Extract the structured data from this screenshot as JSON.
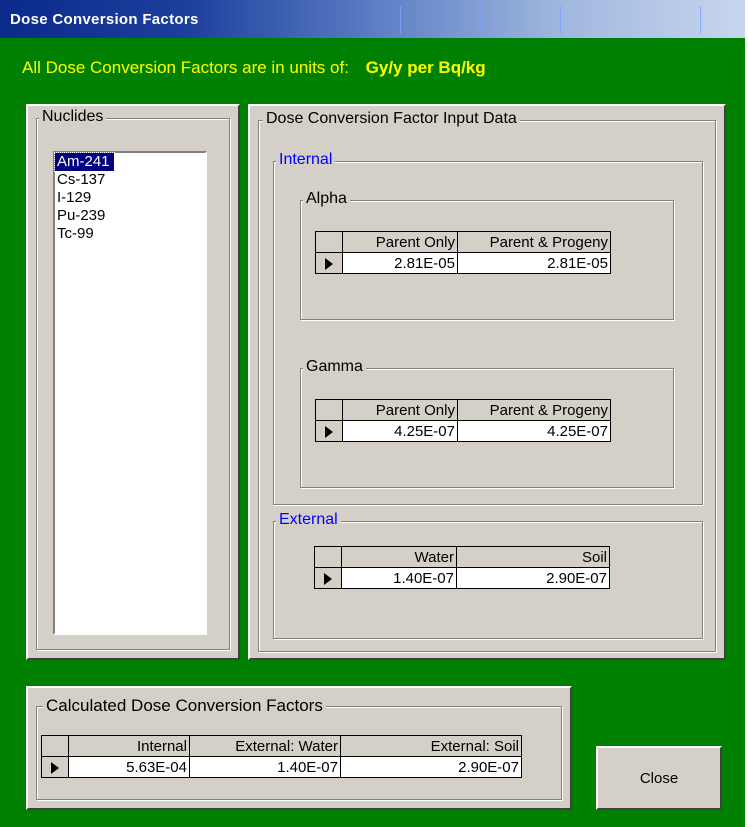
{
  "window": {
    "title": "Dose Conversion Factors"
  },
  "units": {
    "label": "All Dose Conversion Factors are in units of:",
    "value": "Gy/y per Bq/kg"
  },
  "nuclides": {
    "legend": "Nuclides",
    "items": [
      "Am-241",
      "Cs-137",
      "I-129",
      "Pu-239",
      "Tc-99"
    ],
    "selected_index": 0
  },
  "input_data": {
    "legend": "Dose Conversion Factor Input Data",
    "internal": {
      "legend": "Internal",
      "alpha": {
        "legend": "Alpha",
        "headers": [
          "Parent Only",
          "Parent & Progeny"
        ],
        "values": [
          "2.81E-05",
          "2.81E-05"
        ]
      },
      "gamma": {
        "legend": "Gamma",
        "headers": [
          "Parent Only",
          "Parent & Progeny"
        ],
        "values": [
          "4.25E-07",
          "4.25E-07"
        ]
      }
    },
    "external": {
      "legend": "External",
      "headers": [
        "Water",
        "Soil"
      ],
      "values": [
        "1.40E-07",
        "2.90E-07"
      ]
    }
  },
  "calculated": {
    "legend": "Calculated Dose Conversion Factors",
    "headers": [
      "Internal",
      "External: Water",
      "External: Soil"
    ],
    "values": [
      "5.63E-04",
      "1.40E-07",
      "2.90E-07"
    ]
  },
  "buttons": {
    "close": "Close"
  },
  "colors": {
    "background": "#008000",
    "units_text": "#ffff00",
    "group_legend_blue": "#0000ff",
    "panel": "#d4d0c8",
    "selection": "#000080"
  }
}
